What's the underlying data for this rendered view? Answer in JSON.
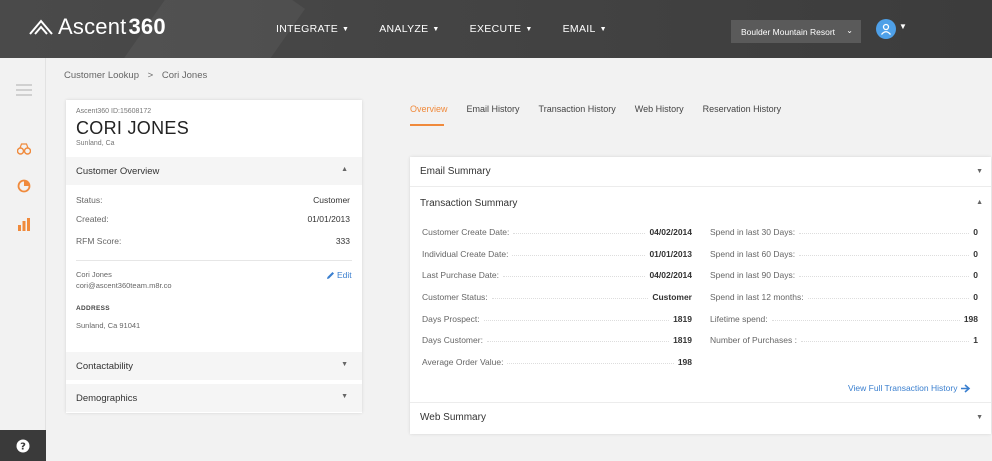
{
  "header": {
    "logo_text": "Ascent",
    "logo_num": "360",
    "nav": [
      {
        "label": "INTEGRATE"
      },
      {
        "label": "ANALYZE"
      },
      {
        "label": "EXECUTE"
      },
      {
        "label": "EMAIL"
      }
    ],
    "account": "Boulder Mountain Resort"
  },
  "breadcrumb": {
    "root": "Customer Lookup",
    "sep": ">",
    "current": "Cori Jones"
  },
  "customer": {
    "id_line": "Ascent360 ID:15608172",
    "name": "CORI JONES",
    "location": "Sunland, Ca",
    "overview_title": "Customer Overview",
    "fields": [
      {
        "label": "Status:",
        "value": "Customer"
      },
      {
        "label": "Created:",
        "value": "01/01/2013"
      },
      {
        "label": "RFM Score:",
        "value": "333"
      }
    ],
    "contact_name": "Cori Jones",
    "contact_email": "cori@ascent360team.m8r.co",
    "edit_label": "Edit",
    "address_label": "ADDRESS",
    "address": "Sunland, Ca 91041",
    "contactability": "Contactability",
    "demographics": "Demographics"
  },
  "tabs": [
    {
      "label": "Overview"
    },
    {
      "label": "Email History"
    },
    {
      "label": "Transaction History"
    },
    {
      "label": "Web History"
    },
    {
      "label": "Reservation History"
    }
  ],
  "summary": {
    "email_title": "Email Summary",
    "transaction_title": "Transaction Summary",
    "web_title": "Web Summary",
    "left": [
      {
        "label": "Customer Create Date:",
        "value": "04/02/2014"
      },
      {
        "label": "Individual Create Date:",
        "value": "01/01/2013"
      },
      {
        "label": "Last Purchase Date:",
        "value": "04/02/2014"
      },
      {
        "label": "Customer Status:",
        "value": "Customer"
      },
      {
        "label": "Days Prospect:",
        "value": "1819"
      },
      {
        "label": "Days Customer:",
        "value": "1819"
      },
      {
        "label": "Average Order Value:",
        "value": "198"
      }
    ],
    "right": [
      {
        "label": "Spend in last 30 Days:",
        "value": "0"
      },
      {
        "label": "Spend in last 60 Days:",
        "value": "0"
      },
      {
        "label": "Spend in last 90 Days:",
        "value": "0"
      },
      {
        "label": "Spend in last 12 months:",
        "value": "0"
      },
      {
        "label": "Lifetime spend:",
        "value": "198"
      },
      {
        "label": "Number of Purchases :",
        "value": "1"
      }
    ],
    "view_full": "View Full Transaction History"
  },
  "colors": {
    "accent_orange": "#f08a3c",
    "link_blue": "#3a7fcf",
    "header_dark": "#444444"
  }
}
